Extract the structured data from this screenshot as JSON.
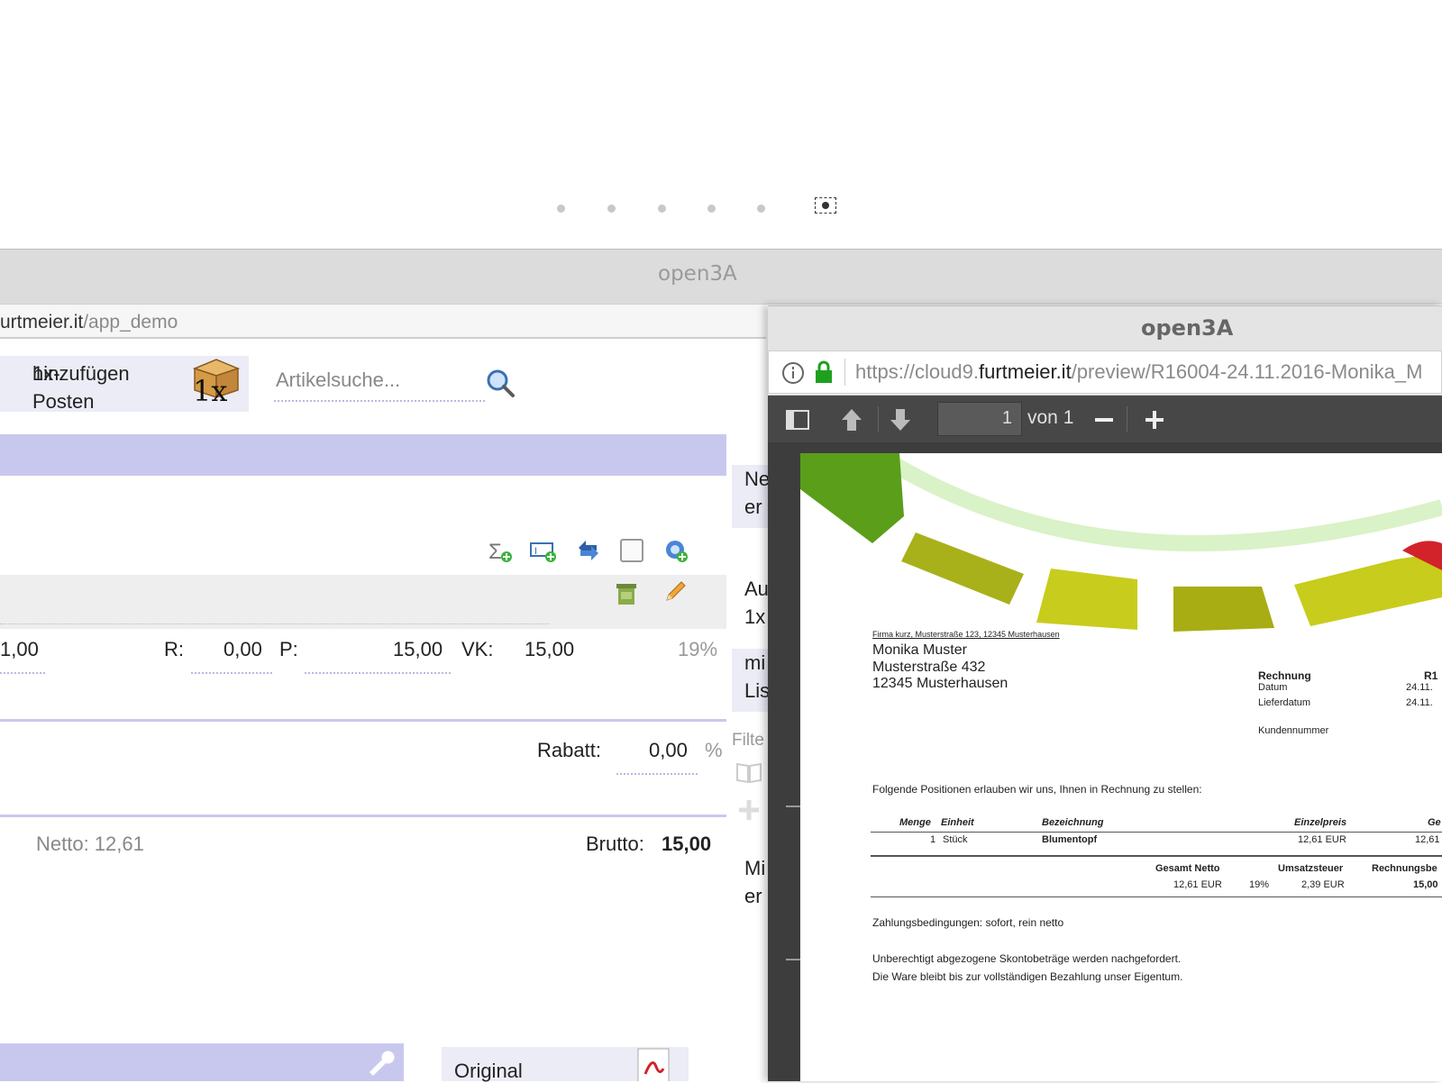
{
  "carousel": {
    "dot_count": 6,
    "active_index": 5
  },
  "back_window": {
    "title": "open3A",
    "url_domain": "urtmeier.it",
    "url_path": "/app_demo",
    "add_button_label_line1": "1x-Posten",
    "add_button_label_line2": "hinzufügen",
    "search_placeholder": "Artikelsuche...",
    "price_row": {
      "qty": "1,00",
      "r_label": "R:",
      "r_value": "0,00",
      "p_label": "P:",
      "p_value": "15,00",
      "vk_label": "VK:",
      "vk_value": "15,00",
      "tax": "19%"
    },
    "rabatt_label": "Rabatt:",
    "rabatt_value": "0,00",
    "rabatt_unit": "%",
    "netto_label": "Netto: 12,61",
    "brutto_label": "Brutto:",
    "brutto_value": "15,00",
    "original_label": "Original",
    "side_cells": [
      "Ne",
      "er",
      "Au",
      "1x",
      "mi",
      "Lis",
      "Filte",
      "Mi",
      "er"
    ]
  },
  "front_window": {
    "title": "open3A",
    "url_prefix": "https://cloud9.",
    "url_domain": "furtmeier.it",
    "url_path": "/preview/R16004-24.11.2016-Monika_M",
    "page_number": "1",
    "page_of": "von 1"
  },
  "invoice": {
    "sender_line": "Firma kurz, Musterstraße 123, 12345 Musterhausen",
    "recipient": [
      "Monika Muster",
      "Musterstraße 432",
      "12345 Musterhausen"
    ],
    "meta_title": "Rechnung",
    "meta_labels": [
      "Datum",
      "Lieferdatum",
      "Kundennummer"
    ],
    "meta_values": [
      "24.11.",
      "24.11."
    ],
    "meta_right_title": "R1",
    "intro": "Folgende Positionen erlauben wir uns, Ihnen in Rechnung zu stellen:",
    "columns": [
      "Menge",
      "Einheit",
      "Bezeichnung",
      "Einzelpreis",
      "Ge"
    ],
    "row": {
      "menge": "1",
      "einheit": "Stück",
      "bezeichnung": "Blumentopf",
      "einzelpreis": "12,61 EUR",
      "gesamt": "12,61"
    },
    "sum_headers": [
      "Gesamt Netto",
      "Umsatzsteuer",
      "Rechnungsbe"
    ],
    "sum_values": {
      "netto": "12,61 EUR",
      "rate": "19%",
      "ust": "2,39 EUR",
      "brutto": "15,00"
    },
    "payment": "Zahlungsbedingungen: sofort, rein netto",
    "note1": "Unberechtigt abgezogene Skontobeträge werden nachgefordert.",
    "note2": "Die Ware bleibt bis zur vollständigen Bezahlung unser Eigentum."
  },
  "colors": {
    "accent_band": "#c8c8ef",
    "light_band": "#ececf7"
  }
}
